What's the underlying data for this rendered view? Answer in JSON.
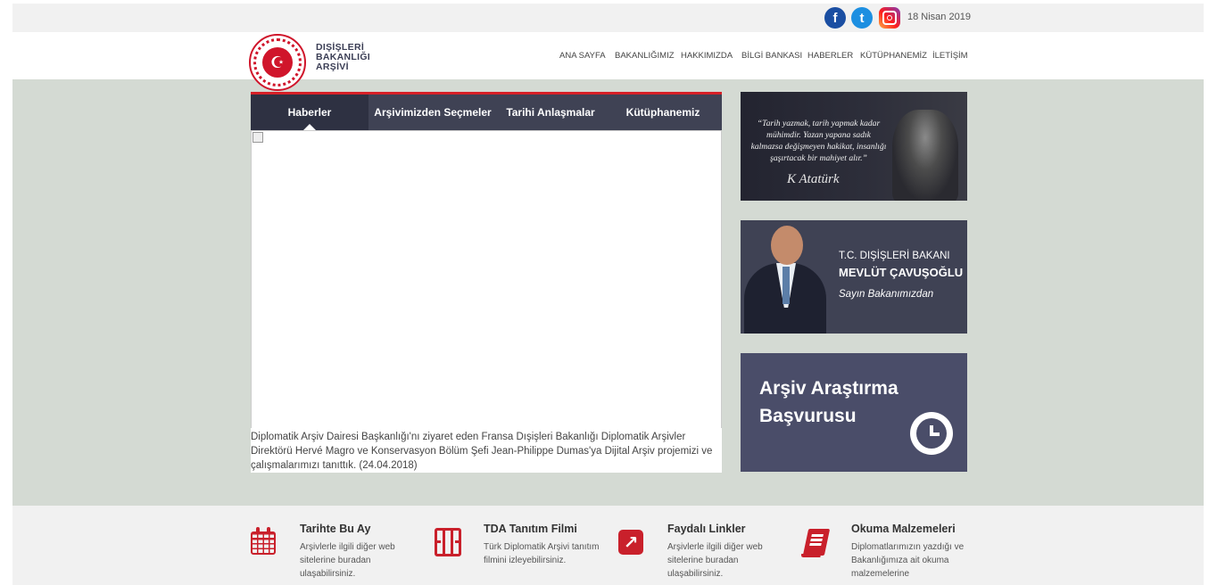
{
  "topbar": {
    "date": "18 Nisan 2019",
    "social": {
      "facebook": "f",
      "twitter": "t"
    }
  },
  "header": {
    "logo_lines": [
      "DIŞİŞLERİ",
      "BAKANLIĞI",
      "ARŞİVİ"
    ],
    "nav": [
      "ANA SAYFA",
      "BAKANLIĞIMIZ",
      "HAKKIMIZDA",
      "BİLGİ BANKASI",
      "HABERLER",
      "KÜTÜPHANEMİZ",
      "İLETİŞİM"
    ]
  },
  "tabs": {
    "items": [
      "Haberler",
      "Arşivimizden Seçmeler",
      "Tarihi Anlaşmalar",
      "Kütüphanemiz"
    ],
    "active": "Haberler"
  },
  "news": {
    "caption": "Diplomatik Arşiv Dairesi Başkanlığı'nı ziyaret eden Fransa Dışişleri Bakanlığı Diplomatik Arşivler Direktörü Hervé Magro ve Konservasyon Bölüm Şefi Jean-Philippe Dumas'ya Dijital Arşiv projemizi ve çalışmalarımızı tanıttık. (24.04.2018)"
  },
  "quote_card": {
    "quote": "“Tarih yazmak, tarih yapmak kadar mühimdir. Yazan yapana sadık kalmazsa değişmeyen hakikat, insanlığı şaşırtacak bir mahiyet alır.”",
    "signature": "K Atatürk"
  },
  "minister_card": {
    "title": "T.C. DIŞİŞLERİ BAKANI",
    "name": "MEVLÜT ÇAVUŞOĞLU",
    "subtitle": "Sayın Bakanımızdan"
  },
  "apply_card": {
    "title": "Arşiv Araştırma Başvurusu"
  },
  "features": [
    {
      "icon": "calendar-icon",
      "title": "Tarihte Bu Ay",
      "desc": "Arşivlerle ilgili diğer web sitelerine buradan ulaşabilirsiniz."
    },
    {
      "icon": "film-icon",
      "title": "TDA Tanıtım Filmi",
      "desc": "Türk Diplomatik Arşivi tanıtım filmini izleyebilirsiniz."
    },
    {
      "icon": "external-link-icon",
      "title": "Faydalı Linkler",
      "desc": "Arşivlerle ilgili diğer web sitelerine buradan ulaşabilirsiniz."
    },
    {
      "icon": "book-icon",
      "title": "Okuma Malzemeleri",
      "desc": "Diplomatlarımızın yazdığı ve Bakanlığımıza ait okuma malzemelerine"
    }
  ],
  "colors": {
    "accent_red": "#c9202b",
    "tab_dark": "#3f4254",
    "main_bg": "#d4dad3",
    "apply_card": "#4a4d69"
  }
}
